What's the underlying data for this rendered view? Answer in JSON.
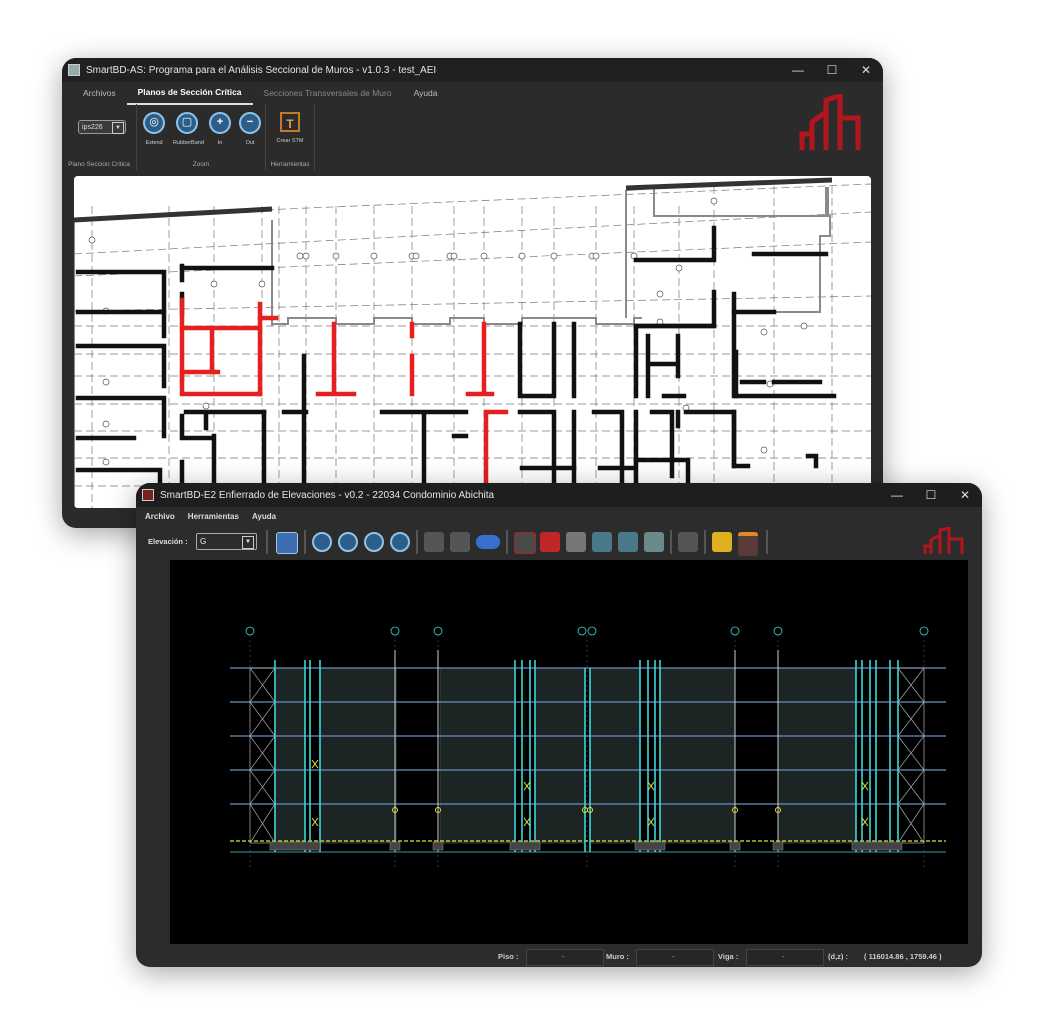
{
  "window1": {
    "title": "SmartBD-AS: Programa para el Análisis Seccional de Muros - v1.0.3 - test_AEI",
    "tabs": [
      "Archivos",
      "Planos de Sección Crítica",
      "Secciones Transversales de Muro",
      "Ayuda"
    ],
    "active_tab": "Planos de Sección Crítica",
    "ribbon": {
      "plane_select_value": "ips226",
      "group_plane_label": "Plano Seccion Critica",
      "zoom_buttons": [
        "Extend",
        "RubberBand",
        "In",
        "Out"
      ],
      "group_zoom_label": "Zoom",
      "stm_button": "Crear STM",
      "group_tools_label": "Herramientas"
    },
    "win_buttons": [
      "—",
      "☐",
      "✕"
    ]
  },
  "window2": {
    "title": "SmartBD-E2 Enfierrado de Elevaciones - v0.2 - 22034 Condominio Abichita",
    "menu": [
      "Archivo",
      "Herramientas",
      "Ayuda"
    ],
    "elevation_label": "Elevación :",
    "elevation_value": "G",
    "status": {
      "piso_label": "Piso :",
      "piso_value": "-",
      "muro_label": "Muro :",
      "muro_value": "-",
      "viga_label": "Viga :",
      "viga_value": "-",
      "coord_label": "(d,z) :",
      "coord_value": "( 116014.86 , 1759.46 )"
    },
    "win_buttons": [
      "—",
      "☐",
      "✕"
    ]
  },
  "colors": {
    "accent_red": "#b0161c",
    "selected_walls": "#e52020",
    "elevation_cyan": "#3fd6d6",
    "elevation_yellow": "#e8e030"
  }
}
